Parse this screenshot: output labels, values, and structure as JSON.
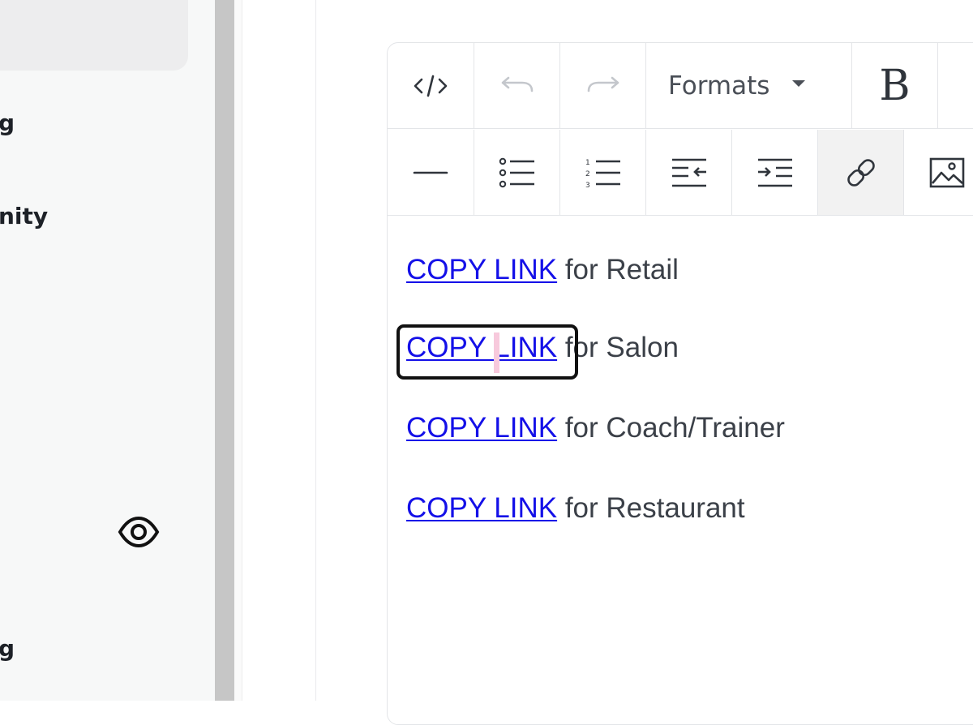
{
  "sidebar": {
    "partial_labels": [
      "g",
      "nity",
      ",",
      "g"
    ]
  },
  "toolbar": {
    "code_view": "code-view",
    "undo": "undo",
    "redo": "redo",
    "formats_label": "Formats",
    "bold_label": "B",
    "row2": [
      "horizontal-rule",
      "bulleted-list",
      "numbered-list",
      "outdent",
      "indent",
      "insert-link",
      "insert-image"
    ]
  },
  "editor": {
    "lines": [
      {
        "link": "COPY LINK",
        "text": " for Retail"
      },
      {
        "link": "COPY LINK",
        "text": " for Salon"
      },
      {
        "link": "COPY LINK",
        "text": " for Coach/Trainer"
      },
      {
        "link": "COPY LINK",
        "text": " for Restaurant"
      }
    ]
  },
  "colors": {
    "link": "#1410e8",
    "text": "#3b4048",
    "highlight_border": "#111111",
    "cursor": "#f7c9dc"
  }
}
